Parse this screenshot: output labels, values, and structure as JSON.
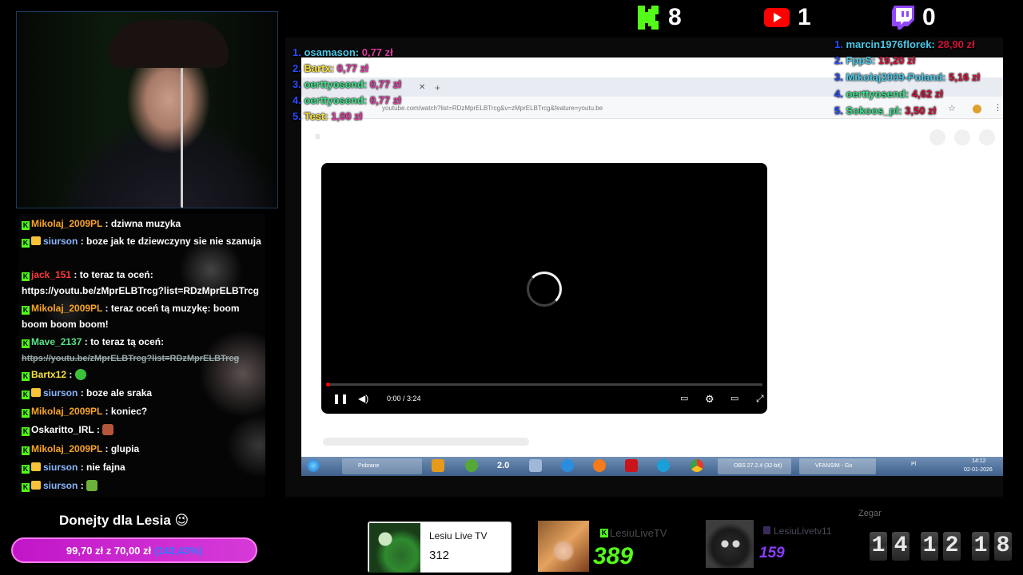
{
  "counters": {
    "kick": "8",
    "youtube": "1",
    "twitch": "0"
  },
  "top_donors_left": [
    {
      "rank": "1.",
      "name": "osamason:",
      "amount": "0,77 zł"
    },
    {
      "rank": "2.",
      "name": "Bartx:",
      "amount": "0,77 zł"
    },
    {
      "rank": "3.",
      "name": "oerttyosend:",
      "amount": "0,77 zł"
    },
    {
      "rank": "4.",
      "name": "oerttyosend:",
      "amount": "0,77 zł"
    },
    {
      "rank": "5.",
      "name": "Test:",
      "amount": "1,00 zł"
    }
  ],
  "top_donors_right": [
    {
      "rank": "1.",
      "name": "marcin1976florek:",
      "amount": "28,90 zł"
    },
    {
      "rank": "2.",
      "name": "FppS:",
      "amount": "19,20 zł"
    },
    {
      "rank": "3.",
      "name": "Mikolaj2009-Poland:",
      "amount": "5,16 zł"
    },
    {
      "rank": "4.",
      "name": "oerttyosend:",
      "amount": "4,62 zł"
    },
    {
      "rank": "5.",
      "name": "Sokoos_pl:",
      "amount": "3,50 zł"
    }
  ],
  "chat": [
    {
      "user": "Mikolaj_2009PL",
      "badges": [
        "kick"
      ],
      "color": "orange",
      "text": ": dziwna muzyka"
    },
    {
      "user": "siurson",
      "badges": [
        "kick",
        "sub"
      ],
      "color": "blue",
      "text": ": boze jak te dziewczyny sie nie szanuja"
    },
    {
      "user": "jack_151",
      "badges": [
        "kick"
      ],
      "color": "red",
      "text": ": to teraz ta oceń: https://youtu.be/zMprELBTrcg?list=RDzMprELBTrcg"
    },
    {
      "user": "Mikolaj_2009PL",
      "badges": [
        "kick"
      ],
      "color": "orange",
      "text": ": teraz oceń tą muzykę: boom boom boom boom!"
    },
    {
      "user": "Mave_2137",
      "badges": [
        "kick"
      ],
      "color": "green",
      "text": ": to teraz tą oceń:"
    },
    {
      "user": "",
      "badges": [],
      "color": "",
      "text": "https://youtu.be/zMprELBTrcg?list=RDzMprELBTrcg"
    },
    {
      "user": "Bartx12",
      "badges": [
        "kick"
      ],
      "color": "yellow",
      "text": ":"
    },
    {
      "user": "siurson",
      "badges": [
        "kick",
        "sub"
      ],
      "color": "blue",
      "text": ": boze ale sraka"
    },
    {
      "user": "Mikolaj_2009PL",
      "badges": [
        "kick"
      ],
      "color": "orange",
      "text": ": koniec?"
    },
    {
      "user": "Oskaritto_IRL",
      "badges": [
        "kick"
      ],
      "color": "white",
      "text": ":"
    },
    {
      "user": "Mikolaj_2009PL",
      "badges": [
        "kick"
      ],
      "color": "orange",
      "text": ": glupia"
    },
    {
      "user": "siurson",
      "badges": [
        "kick",
        "sub"
      ],
      "color": "blue",
      "text": ": nie fajna"
    },
    {
      "user": "siurson",
      "badges": [
        "kick",
        "sub"
      ],
      "color": "blue",
      "text": ":"
    }
  ],
  "browser": {
    "url": "youtube.com/watch?list=RDzMprELBTrcg&v=zMprELBTrcg&feature=youtu.be",
    "timecode": "0:00 / 3:24"
  },
  "taskbar": {
    "items": [
      "Pobrane",
      "2.0",
      "OBS 27.2.4 (32-bit)",
      "VFANSIM - Go"
    ],
    "clock_time": "14:12",
    "clock_date": "02-01-2026",
    "lang": "Pl"
  },
  "goal": {
    "title": "Donejty dla Lesia 😉",
    "amount_text": "99,70 zł z 70,00 zł",
    "percent": "(142,43%)",
    "progress_fraction": 1.4243
  },
  "channels": [
    {
      "name": "Lesiu Live TV",
      "count": "312"
    },
    {
      "name": "LesiuLiveTV",
      "count": "389"
    },
    {
      "name": "LesiuLivetv11",
      "count": "159"
    }
  ],
  "clock": {
    "label": "Zegar",
    "digits": [
      "1",
      "4",
      "1",
      "2",
      "1",
      "8"
    ]
  },
  "colors": {
    "kick": "#53fc18",
    "youtube": "#ff0000",
    "twitch": "#9146ff",
    "goal": "#c116c8"
  }
}
